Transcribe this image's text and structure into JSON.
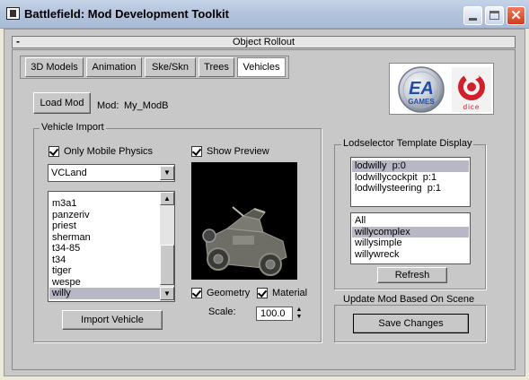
{
  "window": {
    "title": "Battlefield: Mod Development Toolkit"
  },
  "rollout": {
    "toggle": "-",
    "title": "Object Rollout"
  },
  "tabs": [
    {
      "label": "3D Models"
    },
    {
      "label": "Animation"
    },
    {
      "label": "Ske/Skn"
    },
    {
      "label": "Trees"
    },
    {
      "label": "Vehicles",
      "active": true
    }
  ],
  "logos": {
    "ea": "EA",
    "ea_sub": "GAMES",
    "dice": "dice"
  },
  "load_mod": {
    "button": "Load Mod",
    "mod_label": "Mod:",
    "mod_value": "My_ModB"
  },
  "vehicle_import": {
    "title": "Vehicle Import",
    "only_mobile_physics": {
      "label": "Only Mobile Physics",
      "checked": true
    },
    "show_preview": {
      "label": "Show Preview",
      "checked": true
    },
    "class_select": {
      "value": "VCLand"
    },
    "vehicles": [
      "m3a1",
      "panzeriv",
      "priest",
      "sherman",
      "t34-85",
      "t34",
      "tiger",
      "wespe",
      "willy"
    ],
    "selected_vehicle": "willy",
    "import_button": "Import Vehicle",
    "geometry": {
      "label": "Geometry",
      "checked": true
    },
    "material": {
      "label": "Material",
      "checked": true
    },
    "scale": {
      "label": "Scale:",
      "value": "100.0"
    }
  },
  "lod_selector": {
    "title": "Lodselector Template Display",
    "lods": [
      "lodwilly  p:0",
      "lodwillycockpit  p:1",
      "lodwillysteering  p:1"
    ],
    "selected_lod": "lodwilly  p:0",
    "templates": [
      "All",
      "willycomplex",
      "willysimple",
      "willywreck"
    ],
    "selected_template": "willycomplex",
    "refresh_button": "Refresh"
  },
  "update_mod": {
    "title": "Update Mod Based On Scene",
    "save_button": "Save Changes"
  },
  "colors": {
    "selection": "#b7b7c6",
    "panel": "#c8c8c8",
    "close_red": "#cf3c1d",
    "dice_red": "#d0202a",
    "ea_blue": "#1f4fa8"
  }
}
